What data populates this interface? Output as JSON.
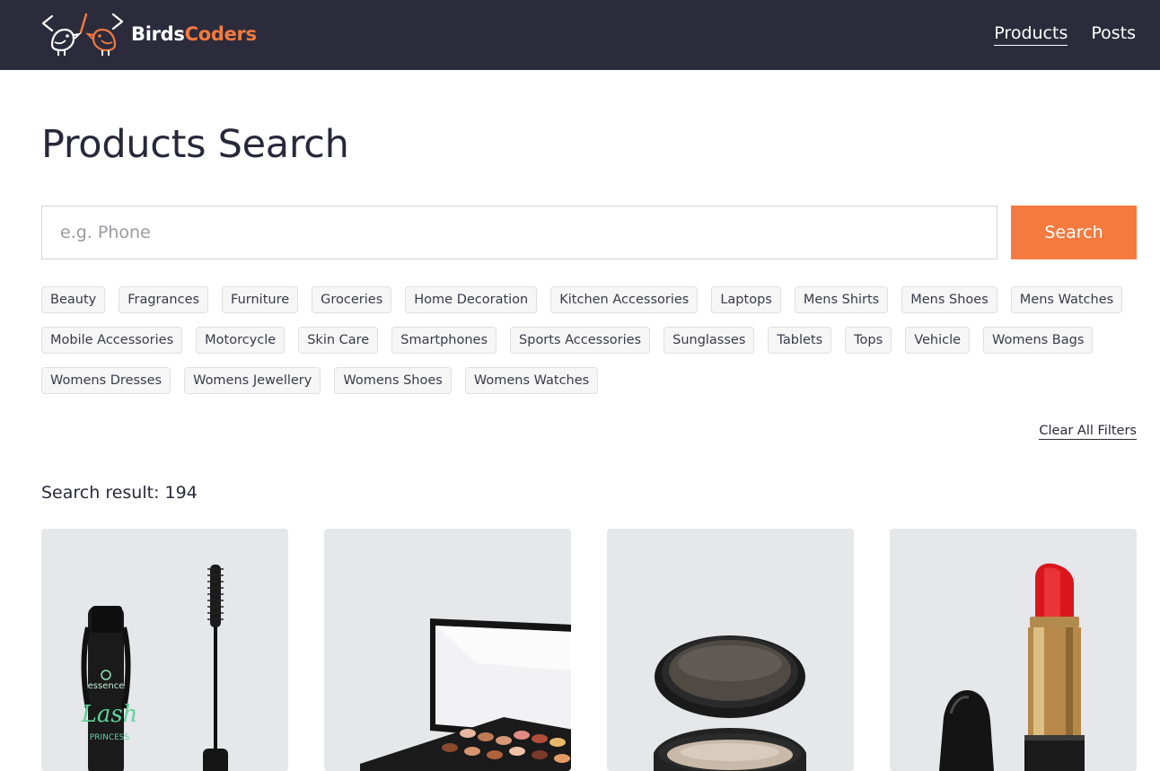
{
  "brand": {
    "name_part1": "Birds",
    "name_part2": "Coders",
    "accent": "#f47a3f",
    "header_bg": "#2b2b3b"
  },
  "nav": {
    "items": [
      {
        "label": "Products",
        "active": true
      },
      {
        "label": "Posts",
        "active": false
      }
    ]
  },
  "page": {
    "title": "Products Search"
  },
  "search": {
    "placeholder": "e.g. Phone",
    "value": "",
    "button_label": "Search"
  },
  "categories": [
    "Beauty",
    "Fragrances",
    "Furniture",
    "Groceries",
    "Home Decoration",
    "Kitchen Accessories",
    "Laptops",
    "Mens Shirts",
    "Mens Shoes",
    "Mens Watches",
    "Mobile Accessories",
    "Motorcycle",
    "Skin Care",
    "Smartphones",
    "Sports Accessories",
    "Sunglasses",
    "Tablets",
    "Tops",
    "Vehicle",
    "Womens Bags",
    "Womens Dresses",
    "Womens Jewellery",
    "Womens Shoes",
    "Womens Watches"
  ],
  "filters": {
    "clear_label": "Clear All Filters"
  },
  "results": {
    "label": "Search result:",
    "count": "194"
  },
  "products": [
    {
      "icon": "mascara-image",
      "brand_text": "essence",
      "title_text": "Lash",
      "subtitle_text": "PRINCESS"
    },
    {
      "icon": "eyeshadow-palette-image"
    },
    {
      "icon": "powder-compact-image"
    },
    {
      "icon": "red-lipstick-image"
    }
  ]
}
